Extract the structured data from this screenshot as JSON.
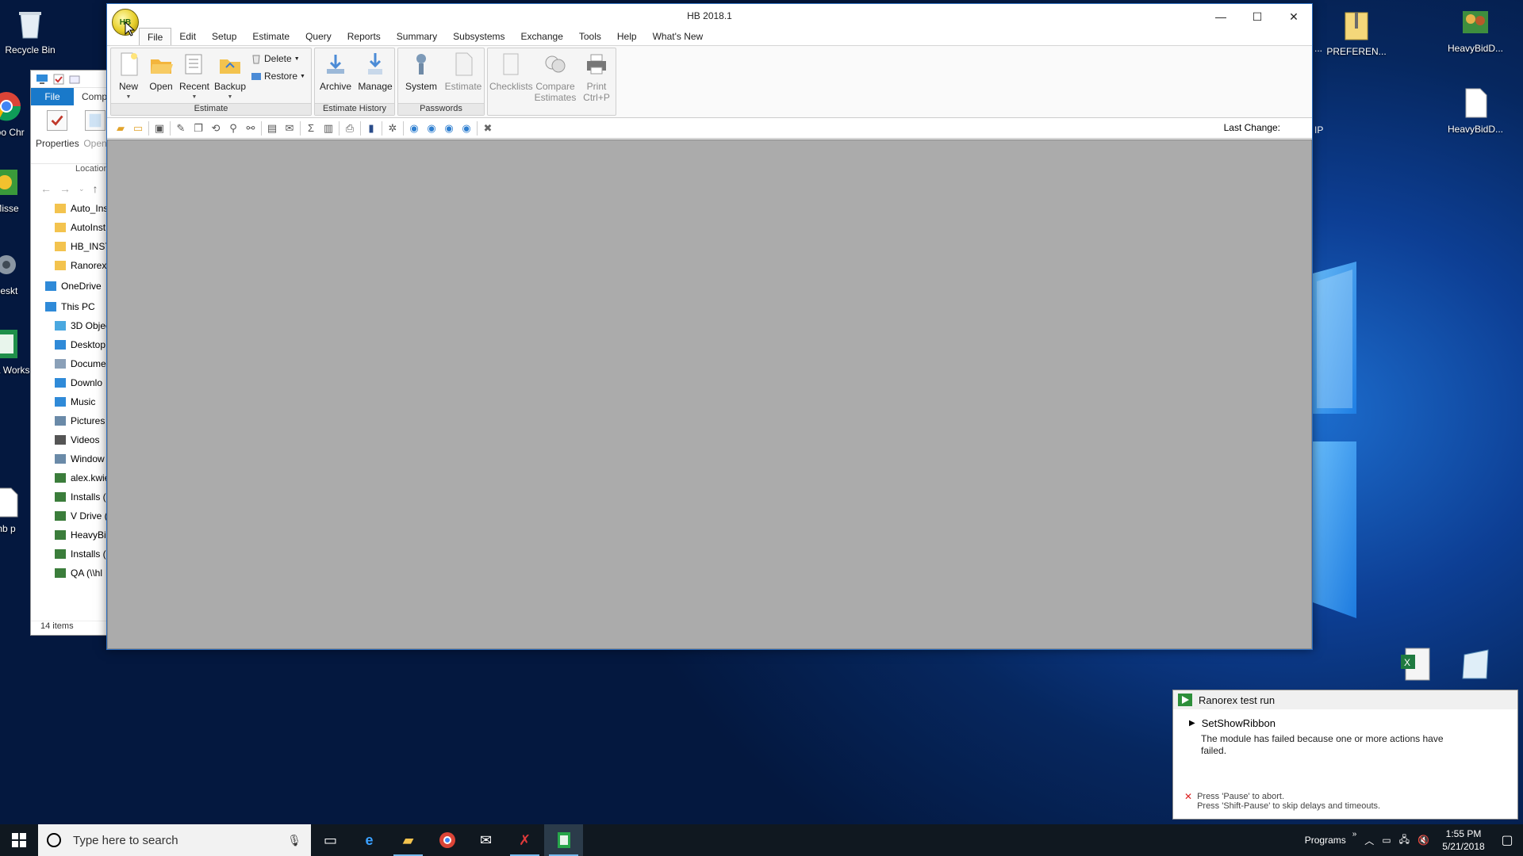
{
  "desktop": {
    "icons_left": [
      {
        "label": "Recycle Bin"
      },
      {
        "label": "Goo Chr"
      },
      {
        "label": "Misse"
      },
      {
        "label": "deskt"
      },
      {
        "label": "Hea Works"
      },
      {
        "label": "hb p"
      }
    ],
    "icons_right": [
      {
        "label": "PREFEREN..."
      },
      {
        "label": "HeavyBidD..."
      },
      {
        "label": "HeavyBidD..."
      },
      {
        "label": "IP"
      }
    ],
    "partial_label_left": "..."
  },
  "explorer": {
    "tabs": {
      "file": "File",
      "comp": "Comp"
    },
    "ribbon": {
      "properties": "Properties",
      "open": "Open"
    },
    "location_label": "Location",
    "tree": [
      {
        "label": "Auto_Ins",
        "icon": "folder-icon"
      },
      {
        "label": "AutoInst",
        "icon": "folder-icon"
      },
      {
        "label": "HB_INST",
        "icon": "folder-icon"
      },
      {
        "label": "Ranorex",
        "icon": "folder-icon"
      },
      {
        "label": "OneDrive",
        "icon": "cloud-icon"
      },
      {
        "label": "This PC",
        "icon": "pc-icon"
      },
      {
        "label": "3D Objec",
        "icon": "cube-icon"
      },
      {
        "label": "Desktop",
        "icon": "desktop-icon"
      },
      {
        "label": "Docume",
        "icon": "document-icon"
      },
      {
        "label": "Downlo",
        "icon": "download-icon"
      },
      {
        "label": "Music",
        "icon": "music-icon"
      },
      {
        "label": "Pictures",
        "icon": "pictures-icon"
      },
      {
        "label": "Videos",
        "icon": "video-icon"
      },
      {
        "label": "Window",
        "icon": "drive-icon"
      },
      {
        "label": "alex.kwie",
        "icon": "network-drive-icon"
      },
      {
        "label": "Installs (",
        "icon": "network-drive-icon"
      },
      {
        "label": "V Drive (",
        "icon": "network-drive-icon"
      },
      {
        "label": "HeavyBi",
        "icon": "network-drive-icon"
      },
      {
        "label": "Installs (",
        "icon": "network-drive-icon"
      },
      {
        "label": "QA (\\\\hl",
        "icon": "network-drive-icon"
      }
    ],
    "status": "14 items"
  },
  "window": {
    "title": "HB 2018.1",
    "controls": {
      "minimize": "—",
      "maximize": "☐",
      "close": "✕"
    },
    "orb_text": "HB",
    "menu": [
      "File",
      "Edit",
      "Setup",
      "Estimate",
      "Query",
      "Reports",
      "Summary",
      "Subsystems",
      "Exchange",
      "Tools",
      "Help",
      "What's New"
    ],
    "ribbon": {
      "estimate_group": {
        "label": "Estimate",
        "new": "New",
        "open": "Open",
        "recent": "Recent",
        "backup": "Backup",
        "delete": "Delete",
        "restore": "Restore"
      },
      "history_group": {
        "label": "Estimate History",
        "archive": "Archive",
        "manage": "Manage"
      },
      "passwords_group": {
        "label": "Passwords",
        "system": "System",
        "estimate": "Estimate"
      },
      "misc_group": {
        "checklists": "Checklists",
        "compare": "Compare",
        "compare2": "Estimates",
        "print": "Print",
        "print_shortcut": "Ctrl+P"
      }
    },
    "toolbar": {
      "last_change_label": "Last Change:"
    }
  },
  "toast": {
    "title": "Ranorex test run",
    "module": "SetShowRibbon",
    "message": "The module has failed because one or more actions have failed.",
    "footer1": "Press 'Pause' to abort.",
    "footer2": "Press 'Shift-Pause' to skip delays and timeouts."
  },
  "taskbar": {
    "search_placeholder": "Type here to search",
    "programs_label": "Programs",
    "time": "1:55 PM",
    "date": "5/21/2018"
  },
  "colors": {
    "accent": "#1979ca",
    "client_bg": "#ababab",
    "taskbar": "#101820"
  }
}
